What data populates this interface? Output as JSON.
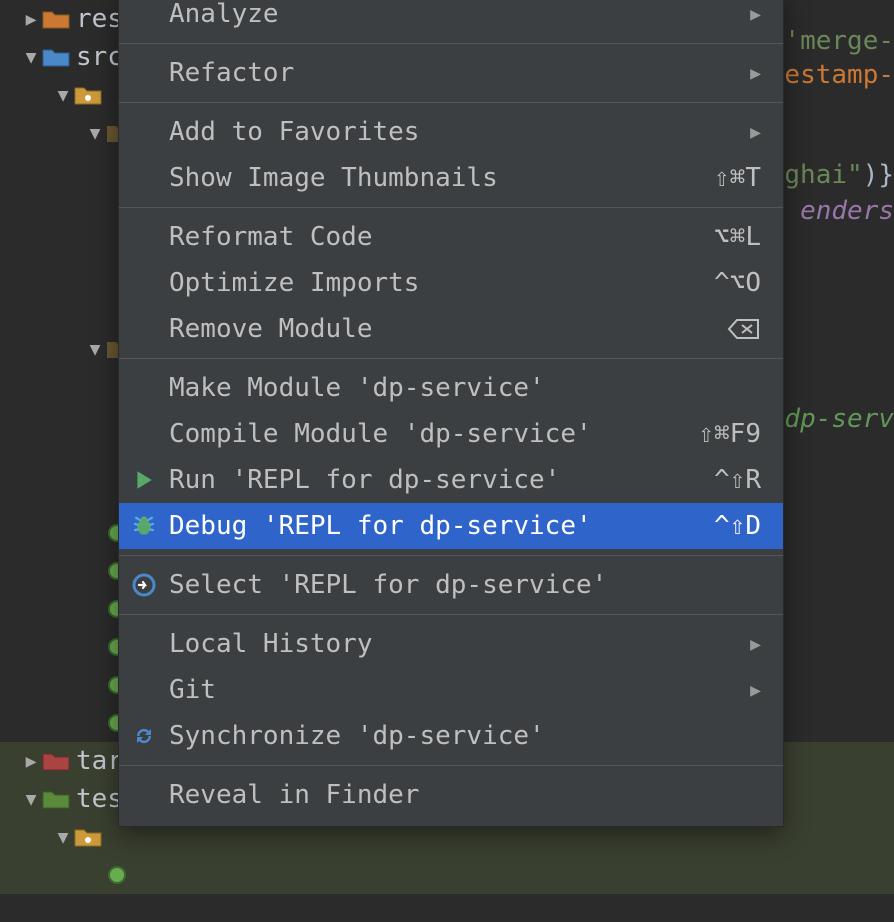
{
  "tree": {
    "row_partial_top": {
      "label": ""
    },
    "row_res": {
      "label": "res"
    },
    "row_src": {
      "label": "src"
    },
    "row_c": {
      "label": ""
    },
    "row_targ": {
      "label": "targ"
    },
    "row_test": {
      "label": "test"
    },
    "row_c2": {
      "label": ""
    }
  },
  "code": {
    "frag1": "'merge-",
    "frag2": "estamp-",
    "frag3_a": "ghai\"",
    "frag3_b": ")}",
    "frag4": "enders",
    "frag5": "dp-serv"
  },
  "menu": [
    {
      "type": "item",
      "label": "Analyze",
      "sub": true
    },
    {
      "type": "sep"
    },
    {
      "type": "item",
      "label": "Refactor",
      "sub": true
    },
    {
      "type": "sep"
    },
    {
      "type": "item",
      "label": "Add to Favorites",
      "sub": true
    },
    {
      "type": "item",
      "label": "Show Image Thumbnails",
      "shortcut": "⇧⌘T"
    },
    {
      "type": "sep"
    },
    {
      "type": "item",
      "label": "Reformat Code",
      "shortcut": "⌥⌘L"
    },
    {
      "type": "item",
      "label": "Optimize Imports",
      "shortcut": "^⌥O"
    },
    {
      "type": "item",
      "label": "Remove Module",
      "shortcut_icon": "delete"
    },
    {
      "type": "sep"
    },
    {
      "type": "item",
      "label": "Make Module 'dp-service'"
    },
    {
      "type": "item",
      "label": "Compile Module 'dp-service'",
      "shortcut": "⇧⌘F9"
    },
    {
      "type": "item",
      "label": "Run 'REPL for dp-service'",
      "shortcut": "^⇧R",
      "icon": "run"
    },
    {
      "type": "item",
      "label": "Debug 'REPL for dp-service'",
      "shortcut": "^⇧D",
      "icon": "bug",
      "highlight": true
    },
    {
      "type": "sep"
    },
    {
      "type": "item",
      "label": "Select 'REPL for dp-service'",
      "icon": "select"
    },
    {
      "type": "sep"
    },
    {
      "type": "item",
      "label": "Local History",
      "sub": true
    },
    {
      "type": "item",
      "label": "Git",
      "sub": true
    },
    {
      "type": "item",
      "label": "Synchronize 'dp-service'",
      "icon": "sync"
    },
    {
      "type": "sep"
    },
    {
      "type": "item",
      "label": "Reveal in Finder"
    }
  ]
}
